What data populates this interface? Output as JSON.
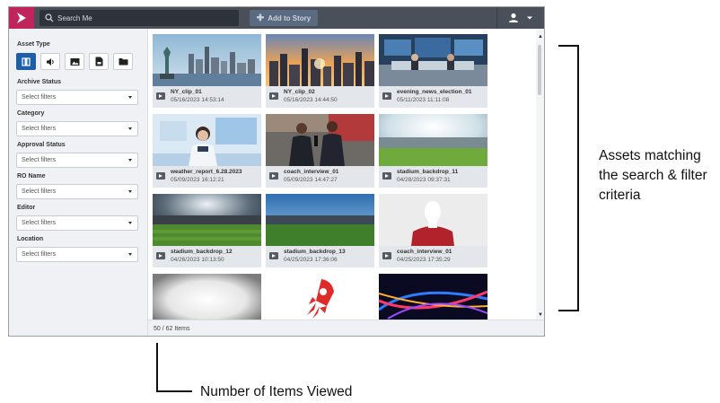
{
  "topbar": {
    "search_placeholder": "Search Me",
    "add_to_story_label": "Add to Story",
    "icons": {
      "logo": "app-logo-icon",
      "search": "search-icon",
      "add": "plus-icon",
      "user": "user-icon",
      "dropdown": "chevron-down-icon"
    }
  },
  "sidebar": {
    "asset_type": {
      "label": "Asset Type",
      "types": [
        {
          "icon": "video-icon",
          "active": true
        },
        {
          "icon": "audio-icon",
          "active": false
        },
        {
          "icon": "image-icon",
          "active": false
        },
        {
          "icon": "document-icon",
          "active": false
        },
        {
          "icon": "folder-icon",
          "active": false
        }
      ]
    },
    "filters": [
      {
        "label": "Archive Status",
        "value": "Select filters"
      },
      {
        "label": "Category",
        "value": "Select filters"
      },
      {
        "label": "Approval Status",
        "value": "Select filters"
      },
      {
        "label": "RO Name",
        "value": "Select filters"
      },
      {
        "label": "Editor",
        "value": "Select filters"
      },
      {
        "label": "Location",
        "value": "Select filters"
      }
    ]
  },
  "assets": [
    {
      "name": "NY_clip_01",
      "date": "05/16/2023 14:53:14",
      "thumb": "city-skyline"
    },
    {
      "name": "NY_clip_02",
      "date": "05/16/2023 14:44:50",
      "thumb": "city-sunset"
    },
    {
      "name": "evening_news_election_01",
      "date": "05/11/2023 11:11:08",
      "thumb": "newsroom"
    },
    {
      "name": "weather_report_6.28.2023",
      "date": "05/09/2023 16:12:21",
      "thumb": "presenter"
    },
    {
      "name": "coach_interview_01",
      "date": "05/09/2023 14:47:27",
      "thumb": "interview"
    },
    {
      "name": "stadium_backdrop_11",
      "date": "04/28/2023 09:37:31",
      "thumb": "stadium-light"
    },
    {
      "name": "stadium_backdrop_12",
      "date": "04/26/2023 10:13:50",
      "thumb": "stadium-dark"
    },
    {
      "name": "stadium_backdrop_13",
      "date": "04/25/2023 17:36:06",
      "thumb": "stadium-day"
    },
    {
      "name": "coach_interview_01",
      "date": "04/25/2023 17:35:29",
      "thumb": "silhouette"
    },
    {
      "name": "",
      "date": "",
      "thumb": "white-vignette"
    },
    {
      "name": "",
      "date": "",
      "thumb": "rocket-logo"
    },
    {
      "name": "",
      "date": "",
      "thumb": "light-streaks"
    }
  ],
  "footer": {
    "count_text": "50 / 62 Items"
  },
  "callouts": {
    "right": "Assets matching the search & filter criteria",
    "bottom": "Number of Items Viewed"
  }
}
